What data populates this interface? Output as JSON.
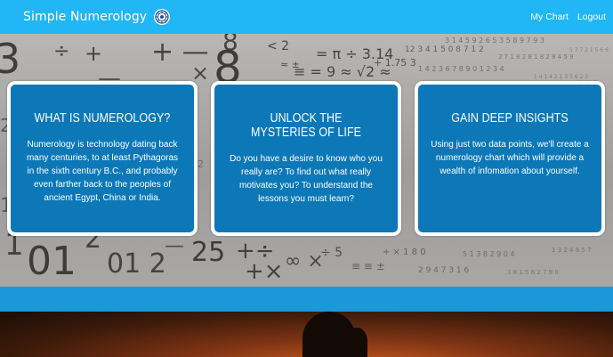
{
  "header": {
    "brand": "Simple Numerology",
    "logo_icon": "numerology-wheel-icon",
    "nav": [
      {
        "label": "My Chart"
      },
      {
        "label": "Logout"
      }
    ]
  },
  "cards": [
    {
      "title": "WHAT IS NUMEROLOGY?",
      "body": "Numerology is technology dating back many centuries, to at least Pythagoras in the sixth century B.C., and probably even farther back to the peoples of ancient Egypt, China or India."
    },
    {
      "title": "UNLOCK THE MYSTERIES OF LIFE",
      "body": "Do you have a desire to know who you really are? To find out what really motivates you? To understand the lessons you must learn?"
    },
    {
      "title": "GAIN DEEP INSIGHTS",
      "body": "Using just two data points, we'll create a numerology chart which will provide a wealth of infomation about yourself."
    }
  ],
  "colors": {
    "navbar": "#21b6f5",
    "card": "#0d78b8",
    "band": "#1c97d8"
  }
}
